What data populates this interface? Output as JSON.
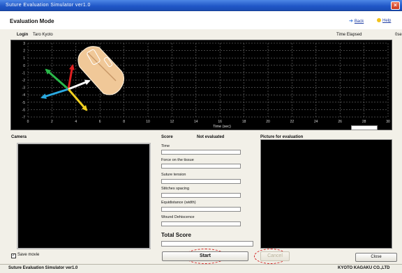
{
  "window": {
    "title": "Suture Evaluation Simulator ver1.0",
    "close_glyph": "×"
  },
  "header": {
    "mode_title": "Evaluation Mode",
    "back_label": "Back",
    "help_label": "Help",
    "accent_color": "#2a6dd9"
  },
  "session": {
    "login_label": "Login",
    "login_user": "Taro Kyoto",
    "elapsed_label": "Time Elapsed",
    "elapsed_value": "0se"
  },
  "graph": {
    "y_ticks": [
      "3",
      "2",
      "1",
      "0",
      "-1",
      "-2",
      "-3",
      "-4",
      "-5",
      "-6",
      "-7"
    ],
    "x_ticks": [
      "0",
      "2",
      "4",
      "6",
      "8",
      "10",
      "12",
      "14",
      "16",
      "18",
      "20",
      "22",
      "24",
      "26",
      "28",
      "30"
    ],
    "x_label": "Time (sec)",
    "axis_colors": [
      "#2ab84a",
      "#e02020",
      "#ffffff",
      "#2aa9e0",
      "#f0d020"
    ]
  },
  "sections": {
    "camera_label": "Camera",
    "score_label": "Score",
    "score_status": "Not evaluated",
    "eval_picture_label": "Picture for evaluation"
  },
  "score_items": [
    {
      "label": "Time"
    },
    {
      "label": "Force on the tissue"
    },
    {
      "label": "Suture tension"
    },
    {
      "label": "Stitches spacing"
    },
    {
      "label": "Equidistance (width)"
    },
    {
      "label": "Wound Dehiscence"
    }
  ],
  "total": {
    "label": "Total Score"
  },
  "controls": {
    "save_movie_label": "Save movie",
    "start_label": "Start",
    "cancel_label": "Cancel",
    "close_label": "Close"
  },
  "statusbar": {
    "left_text": "Suture Evaluation Simulator ver1.0",
    "right_text": "KYOTO KAGAKU CO.,LTD"
  }
}
